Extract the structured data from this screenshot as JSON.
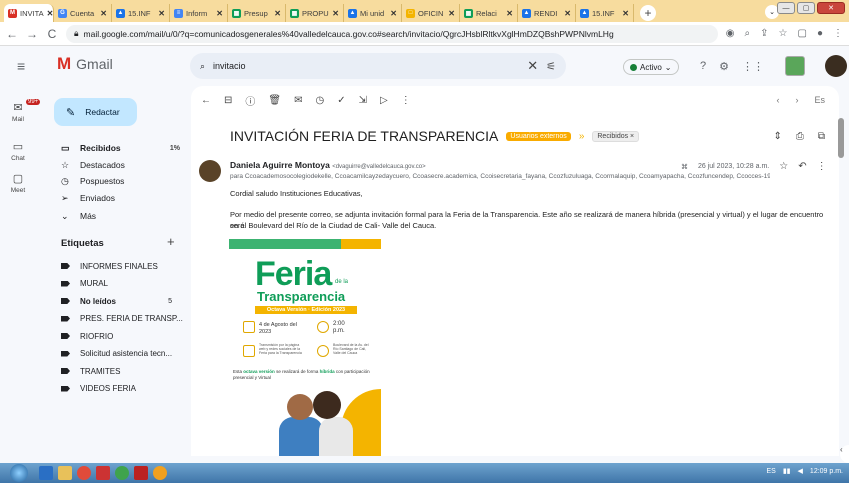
{
  "browser": {
    "tabs": [
      {
        "label": "INVITA",
        "fav": "M",
        "color": "#d93025",
        "active": true
      },
      {
        "label": "Cuenta",
        "fav": "G",
        "color": "#4285f4"
      },
      {
        "label": "15.INF",
        "fav": "▲",
        "color": "#1a73e8"
      },
      {
        "label": "Inform",
        "fav": "≡",
        "color": "#4285f4"
      },
      {
        "label": "Presup",
        "fav": "▦",
        "color": "#0f9d58"
      },
      {
        "label": "PROPU",
        "fav": "▦",
        "color": "#0f9d58"
      },
      {
        "label": "Mi unid",
        "fav": "▲",
        "color": "#1a73e8"
      },
      {
        "label": "OFICIN",
        "fav": "□",
        "color": "#f4b400"
      },
      {
        "label": "Relaci",
        "fav": "▦",
        "color": "#0f9d58"
      },
      {
        "label": "RENDI",
        "fav": "▲",
        "color": "#1a73e8"
      },
      {
        "label": "15.INF",
        "fav": "▲",
        "color": "#1a73e8"
      }
    ],
    "url": "mail.google.com/mail/u/0/?q=comunicadosgenerales%40valledelcauca.gov.co#search/invitacio/QgrcJHsblRltkvXglHmDZQBshPWPNlvmLHg"
  },
  "gmail": {
    "app_name": "Gmail",
    "search_value": "invitacio",
    "status": "Activo",
    "rail": {
      "mail": "Mail",
      "mail_badge": "99+",
      "chat": "Chat",
      "meet": "Meet"
    },
    "compose": "Redactar",
    "nav": [
      {
        "label": "Recibidos",
        "count": "1%",
        "bold": true,
        "icon": "inbox-icon",
        "glyph": "▭"
      },
      {
        "label": "Destacados",
        "count": "",
        "icon": "star-icon",
        "glyph": "☆"
      },
      {
        "label": "Pospuestos",
        "count": "",
        "icon": "clock-icon",
        "glyph": "◷"
      },
      {
        "label": "Enviados",
        "count": "",
        "icon": "send-icon",
        "glyph": "➢"
      },
      {
        "label": "Más",
        "count": "",
        "icon": "chevron-down-icon",
        "glyph": "⌄"
      }
    ],
    "labels_title": "Etiquetas",
    "labels": [
      {
        "label": "INFORMES FINALES",
        "count": ""
      },
      {
        "label": "MURAL",
        "count": ""
      },
      {
        "label": "No leídos",
        "count": "5",
        "bold": true
      },
      {
        "label": "PRES. FERIA DE TRANSP...",
        "count": ""
      },
      {
        "label": "RIOFRIO",
        "count": ""
      },
      {
        "label": "Solicitud asistencia tecn...",
        "count": ""
      },
      {
        "label": "TRAMITES",
        "count": ""
      },
      {
        "label": "VIDEOS FERIA",
        "count": ""
      }
    ],
    "toolbar_pager": "Es"
  },
  "email": {
    "subject": "INVITACIÓN FERIA DE TRANSPARENCIA",
    "chip_label_1": "Usuarios externos",
    "chip_label_2": "Recibidos ×",
    "sender_name": "Daniela Aguirre Montoya",
    "sender_email": "<dvaguirre@valledelcauca.gov.co>",
    "recipients": "para Ccoacademosocolegiodekelle, Ccoacamilcayzedaycuero, Ccoasecre.academica, Ccoisecretaria_fayana, Ccozfuzuluaga, Ccormalaquip, Ccoamyapacha, Ccozfuncendep, Ccocces-19 ▾",
    "date": "26 jul 2023, 10:28 a.m.",
    "greeting": "Cordial saludo Instituciones Educativas,",
    "paragraph1": "Por medio del presente correo, se adjunta invitación formal para la Feria de la Transparencia. Este año se realizará de manera híbrida (presencial y virtual) y el lugar de encuentro será",
    "paragraph2": "en el Boulevard del Río de la Ciudad de Cali- Valle del Cauca.",
    "poster": {
      "title": "Feria",
      "de_la": "de la",
      "subtitle": "Transparencia",
      "edition": "Octava Versión · Edición 2023",
      "date": "4 de Agosto del 2023",
      "time": "2:00 p.m.",
      "stream": "Transmisión por la página web y redes sociales de la Feria para la Transparencia",
      "place": "Boulevard de la Av. del Río Santiago de Cali, Valle del Cauca",
      "footer_a": "Esta",
      "footer_b": "octava versión",
      "footer_c": "se realizará de forma",
      "footer_d": "híbrida",
      "footer_e": "con participación presencial y Virtual"
    }
  },
  "taskbar": {
    "lang": "ES",
    "time": "12:09 p.m."
  }
}
